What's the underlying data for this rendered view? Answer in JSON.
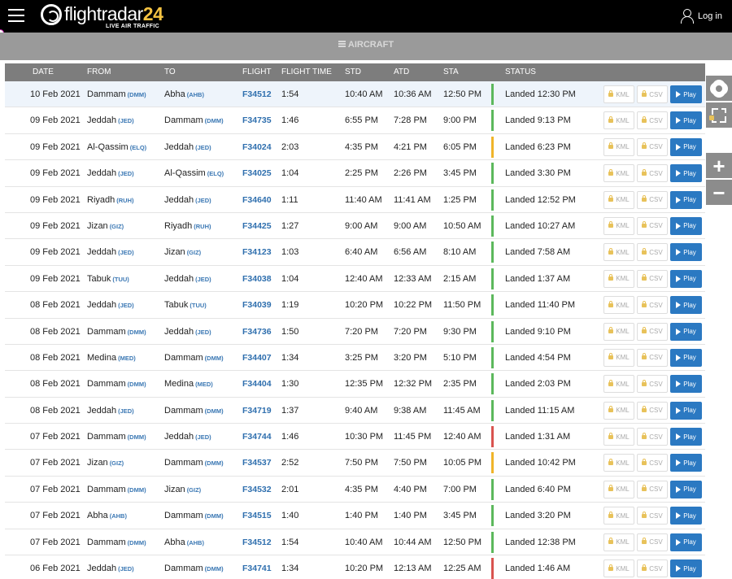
{
  "header": {
    "logo_main": "flightradar",
    "logo_num": "24",
    "logo_sub": "LIVE AIR TRAFFIC",
    "login_label": "Log in"
  },
  "aircraft_bar": {
    "label": "AIRCRAFT"
  },
  "table": {
    "columns": {
      "date": "DATE",
      "from": "FROM",
      "to": "TO",
      "flight": "FLIGHT",
      "flight_time": "FLIGHT TIME",
      "std": "STD",
      "atd": "ATD",
      "sta": "STA",
      "status": "STATUS"
    },
    "buttons": {
      "kml": "KML",
      "csv": "CSV",
      "play": "Play"
    },
    "rows": [
      {
        "date": "10 Feb 2021",
        "from": "Dammam",
        "from_code": "(DMM)",
        "to": "Abha",
        "to_code": "(AHB)",
        "flight": "F34512",
        "flight_time": "1:54",
        "std": "10:40 AM",
        "atd": "10:36 AM",
        "sta": "12:50 PM",
        "status": "Landed 12:30 PM",
        "status_color": "#5cb85c"
      },
      {
        "date": "09 Feb 2021",
        "from": "Jeddah",
        "from_code": "(JED)",
        "to": "Dammam",
        "to_code": "(DMM)",
        "flight": "F34735",
        "flight_time": "1:46",
        "std": "6:55 PM",
        "atd": "7:28 PM",
        "sta": "9:00 PM",
        "status": "Landed 9:13 PM",
        "status_color": "#5cb85c"
      },
      {
        "date": "09 Feb 2021",
        "from": "Al-Qassim",
        "from_code": "(ELQ)",
        "to": "Jeddah",
        "to_code": "(JED)",
        "flight": "F34024",
        "flight_time": "2:03",
        "std": "4:35 PM",
        "atd": "4:21 PM",
        "sta": "6:05 PM",
        "status": "Landed 6:23 PM",
        "status_color": "#f0b429"
      },
      {
        "date": "09 Feb 2021",
        "from": "Jeddah",
        "from_code": "(JED)",
        "to": "Al-Qassim",
        "to_code": "(ELQ)",
        "flight": "F34025",
        "flight_time": "1:04",
        "std": "2:25 PM",
        "atd": "2:26 PM",
        "sta": "3:45 PM",
        "status": "Landed 3:30 PM",
        "status_color": "#5cb85c"
      },
      {
        "date": "09 Feb 2021",
        "from": "Riyadh",
        "from_code": "(RUH)",
        "to": "Jeddah",
        "to_code": "(JED)",
        "flight": "F34640",
        "flight_time": "1:11",
        "std": "11:40 AM",
        "atd": "11:41 AM",
        "sta": "1:25 PM",
        "status": "Landed 12:52 PM",
        "status_color": "#5cb85c"
      },
      {
        "date": "09 Feb 2021",
        "from": "Jizan",
        "from_code": "(GIZ)",
        "to": "Riyadh",
        "to_code": "(RUH)",
        "flight": "F34425",
        "flight_time": "1:27",
        "std": "9:00 AM",
        "atd": "9:00 AM",
        "sta": "10:50 AM",
        "status": "Landed 10:27 AM",
        "status_color": "#5cb85c"
      },
      {
        "date": "09 Feb 2021",
        "from": "Jeddah",
        "from_code": "(JED)",
        "to": "Jizan",
        "to_code": "(GIZ)",
        "flight": "F34123",
        "flight_time": "1:03",
        "std": "6:40 AM",
        "atd": "6:56 AM",
        "sta": "8:10 AM",
        "status": "Landed 7:58 AM",
        "status_color": "#5cb85c"
      },
      {
        "date": "09 Feb 2021",
        "from": "Tabuk",
        "from_code": "(TUU)",
        "to": "Jeddah",
        "to_code": "(JED)",
        "flight": "F34038",
        "flight_time": "1:04",
        "std": "12:40 AM",
        "atd": "12:33 AM",
        "sta": "2:15 AM",
        "status": "Landed 1:37 AM",
        "status_color": "#5cb85c"
      },
      {
        "date": "08 Feb 2021",
        "from": "Jeddah",
        "from_code": "(JED)",
        "to": "Tabuk",
        "to_code": "(TUU)",
        "flight": "F34039",
        "flight_time": "1:19",
        "std": "10:20 PM",
        "atd": "10:22 PM",
        "sta": "11:50 PM",
        "status": "Landed 11:40 PM",
        "status_color": "#5cb85c"
      },
      {
        "date": "08 Feb 2021",
        "from": "Dammam",
        "from_code": "(DMM)",
        "to": "Jeddah",
        "to_code": "(JED)",
        "flight": "F34736",
        "flight_time": "1:50",
        "std": "7:20 PM",
        "atd": "7:20 PM",
        "sta": "9:30 PM",
        "status": "Landed 9:10 PM",
        "status_color": "#5cb85c"
      },
      {
        "date": "08 Feb 2021",
        "from": "Medina",
        "from_code": "(MED)",
        "to": "Dammam",
        "to_code": "(DMM)",
        "flight": "F34407",
        "flight_time": "1:34",
        "std": "3:25 PM",
        "atd": "3:20 PM",
        "sta": "5:10 PM",
        "status": "Landed 4:54 PM",
        "status_color": "#5cb85c"
      },
      {
        "date": "08 Feb 2021",
        "from": "Dammam",
        "from_code": "(DMM)",
        "to": "Medina",
        "to_code": "(MED)",
        "flight": "F34404",
        "flight_time": "1:30",
        "std": "12:35 PM",
        "atd": "12:32 PM",
        "sta": "2:35 PM",
        "status": "Landed 2:03 PM",
        "status_color": "#5cb85c"
      },
      {
        "date": "08 Feb 2021",
        "from": "Jeddah",
        "from_code": "(JED)",
        "to": "Dammam",
        "to_code": "(DMM)",
        "flight": "F34719",
        "flight_time": "1:37",
        "std": "9:40 AM",
        "atd": "9:38 AM",
        "sta": "11:45 AM",
        "status": "Landed 11:15 AM",
        "status_color": "#5cb85c"
      },
      {
        "date": "07 Feb 2021",
        "from": "Dammam",
        "from_code": "(DMM)",
        "to": "Jeddah",
        "to_code": "(JED)",
        "flight": "F34744",
        "flight_time": "1:46",
        "std": "10:30 PM",
        "atd": "11:45 PM",
        "sta": "12:40 AM",
        "status": "Landed 1:31 AM",
        "status_color": "#d9534f"
      },
      {
        "date": "07 Feb 2021",
        "from": "Jizan",
        "from_code": "(GIZ)",
        "to": "Dammam",
        "to_code": "(DMM)",
        "flight": "F34537",
        "flight_time": "2:52",
        "std": "7:50 PM",
        "atd": "7:50 PM",
        "sta": "10:05 PM",
        "status": "Landed 10:42 PM",
        "status_color": "#f0b429"
      },
      {
        "date": "07 Feb 2021",
        "from": "Dammam",
        "from_code": "(DMM)",
        "to": "Jizan",
        "to_code": "(GIZ)",
        "flight": "F34532",
        "flight_time": "2:01",
        "std": "4:35 PM",
        "atd": "4:40 PM",
        "sta": "7:00 PM",
        "status": "Landed 6:40 PM",
        "status_color": "#5cb85c"
      },
      {
        "date": "07 Feb 2021",
        "from": "Abha",
        "from_code": "(AHB)",
        "to": "Dammam",
        "to_code": "(DMM)",
        "flight": "F34515",
        "flight_time": "1:40",
        "std": "1:40 PM",
        "atd": "1:40 PM",
        "sta": "3:45 PM",
        "status": "Landed 3:20 PM",
        "status_color": "#5cb85c"
      },
      {
        "date": "07 Feb 2021",
        "from": "Dammam",
        "from_code": "(DMM)",
        "to": "Abha",
        "to_code": "(AHB)",
        "flight": "F34512",
        "flight_time": "1:54",
        "std": "10:40 AM",
        "atd": "10:44 AM",
        "sta": "12:50 PM",
        "status": "Landed 12:38 PM",
        "status_color": "#5cb85c"
      },
      {
        "date": "06 Feb 2021",
        "from": "Jeddah",
        "from_code": "(JED)",
        "to": "Dammam",
        "to_code": "(DMM)",
        "flight": "F34741",
        "flight_time": "1:34",
        "std": "10:20 PM",
        "atd": "12:13 AM",
        "sta": "12:25 AM",
        "status": "Landed 1:46 AM",
        "status_color": "#d9534f"
      }
    ]
  },
  "side_controls": {
    "settings_icon": "gear-icon",
    "fullscreen_icon": "expand-icon",
    "zoom_in": "+",
    "zoom_out": "−"
  }
}
